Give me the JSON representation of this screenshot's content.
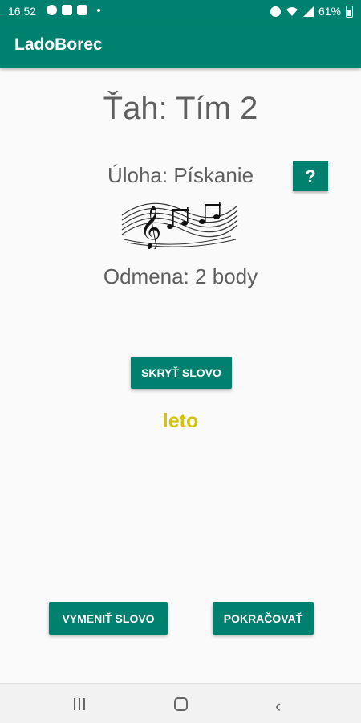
{
  "status": {
    "time": "16:52",
    "battery": "61%",
    "left_icons": [
      "messenger-icon",
      "image-icon",
      "mail-icon",
      "dot-icon"
    ],
    "right_icons": [
      "alarm-icon",
      "wifi-icon",
      "signal-icon",
      "battery-icon"
    ]
  },
  "app": {
    "title": "LadoBorec"
  },
  "game": {
    "turn": "Ťah: Tím 2",
    "task": "Úloha: Pískanie",
    "help_label": "?",
    "reward": "Odmena: 2 body",
    "hide_label": "SKRYŤ SLOVO",
    "word": "leto",
    "swap_label": "VYMENIŤ SLOVO",
    "next_label": "POKRAČOVAŤ"
  },
  "navbar": {
    "icons": [
      "recent-apps-icon",
      "home-icon",
      "back-icon"
    ]
  },
  "colors": {
    "primary": "#00806f",
    "word": "#d4c20c",
    "text": "#5f5f5f"
  }
}
